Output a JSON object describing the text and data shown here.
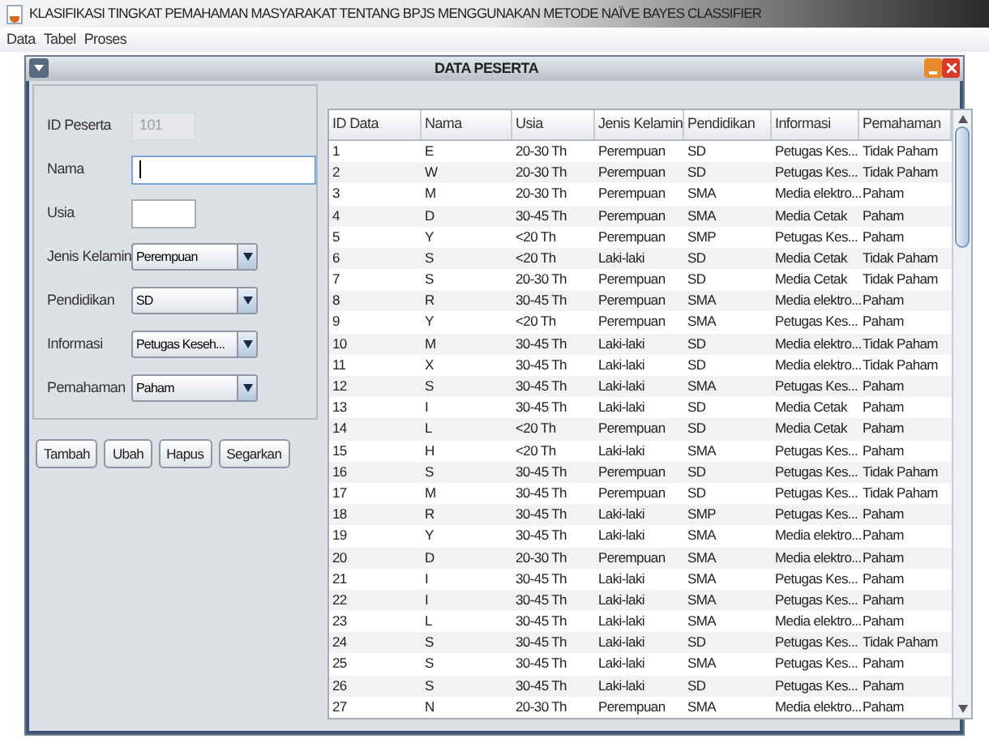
{
  "window": {
    "title": "KLASIFIKASI TINGKAT PEMAHAMAN MASYARAKAT TENTANG BPJS MENGGUNAKAN METODE NAÏVE BAYES CLASSIFIER"
  },
  "menu": [
    "Data",
    "Tabel",
    "Proses"
  ],
  "frame": {
    "title": "DATA PESERTA"
  },
  "form": [
    {
      "kind": "text",
      "label": "ID Peserta",
      "value": "101",
      "disabled": true,
      "focused": false,
      "wide": false
    },
    {
      "kind": "text",
      "label": "Nama",
      "disabled": false,
      "focused": true,
      "wide": true
    },
    {
      "kind": "text",
      "label": "Usia",
      "disabled": false,
      "focused": false,
      "wide": false
    },
    {
      "kind": "combo",
      "label": "Jenis Kelamin",
      "value": "Perempuan"
    },
    {
      "kind": "combo",
      "label": "Pendidikan",
      "value": "SD"
    },
    {
      "kind": "combo",
      "label": "Informasi",
      "value": "Petugas Keseh..."
    },
    {
      "kind": "combo",
      "label": "Pemahaman",
      "value": "Paham"
    }
  ],
  "buttons": [
    "Tambah",
    "Ubah",
    "Hapus",
    "Segarkan"
  ],
  "table": {
    "columns": [
      "ID Data",
      "Nama",
      "Usia",
      "Jenis Kelamin",
      "Pendidikan",
      "Informasi",
      "Pemahaman"
    ],
    "rows": [
      [
        "1",
        "E",
        "20-30 Th",
        "Perempuan",
        "SD",
        "Petugas Kes...",
        "Tidak Paham"
      ],
      [
        "2",
        "W",
        "20-30 Th",
        "Perempuan",
        "SD",
        "Petugas Kes...",
        "Tidak Paham"
      ],
      [
        "3",
        "M",
        "20-30 Th",
        "Perempuan",
        "SMA",
        "Media elektro...",
        "Paham"
      ],
      [
        "4",
        "D",
        "30-45 Th",
        "Perempuan",
        "SMA",
        "Media Cetak",
        "Paham"
      ],
      [
        "5",
        "Y",
        "<20 Th",
        "Perempuan",
        "SMP",
        "Petugas Kes...",
        "Paham"
      ],
      [
        "6",
        "S",
        "<20 Th",
        "Laki-laki",
        "SD",
        "Media Cetak",
        "Tidak Paham"
      ],
      [
        "7",
        "S",
        "20-30 Th",
        "Perempuan",
        "SD",
        "Media Cetak",
        "Tidak Paham"
      ],
      [
        "8",
        "R",
        "30-45 Th",
        "Perempuan",
        "SMA",
        "Media elektro...",
        "Paham"
      ],
      [
        "9",
        "Y",
        "<20 Th",
        "Perempuan",
        "SMA",
        "Petugas Kes...",
        "Paham"
      ],
      [
        "10",
        "M",
        "30-45 Th",
        "Laki-laki",
        "SD",
        "Media elektro...",
        "Tidak Paham"
      ],
      [
        "11",
        "X",
        "30-45 Th",
        "Laki-laki",
        "SD",
        "Media elektro...",
        "Tidak Paham"
      ],
      [
        "12",
        "S",
        "30-45 Th",
        "Laki-laki",
        "SMA",
        "Petugas Kes...",
        "Paham"
      ],
      [
        "13",
        "I",
        "30-45 Th",
        "Laki-laki",
        "SD",
        "Media Cetak",
        "Paham"
      ],
      [
        "14",
        "L",
        "<20 Th",
        "Perempuan",
        "SD",
        "Media Cetak",
        "Paham"
      ],
      [
        "15",
        "H",
        "<20 Th",
        "Laki-laki",
        "SMA",
        "Petugas Kes...",
        "Paham"
      ],
      [
        "16",
        "S",
        "30-45 Th",
        "Perempuan",
        "SD",
        "Petugas Kes...",
        "Tidak Paham"
      ],
      [
        "17",
        "M",
        "30-45 Th",
        "Perempuan",
        "SD",
        "Petugas Kes...",
        "Tidak Paham"
      ],
      [
        "18",
        "R",
        "30-45 Th",
        "Laki-laki",
        "SMP",
        "Petugas Kes...",
        "Paham"
      ],
      [
        "19",
        "Y",
        "30-45 Th",
        "Laki-laki",
        "SMA",
        "Media elektro...",
        "Paham"
      ],
      [
        "20",
        "D",
        "20-30 Th",
        "Perempuan",
        "SMA",
        "Media elektro...",
        "Paham"
      ],
      [
        "21",
        "I",
        "30-45 Th",
        "Laki-laki",
        "SMA",
        "Petugas Kes...",
        "Paham"
      ],
      [
        "22",
        "I",
        "30-45 Th",
        "Laki-laki",
        "SMA",
        "Petugas Kes...",
        "Paham"
      ],
      [
        "23",
        "L",
        "30-45 Th",
        "Laki-laki",
        "SMA",
        "Media elektro...",
        "Paham"
      ],
      [
        "24",
        "S",
        "30-45 Th",
        "Laki-laki",
        "SD",
        "Petugas Kes...",
        "Tidak Paham"
      ],
      [
        "25",
        "S",
        "30-45 Th",
        "Laki-laki",
        "SMA",
        "Petugas Kes...",
        "Paham"
      ],
      [
        "26",
        "S",
        "30-45 Th",
        "Laki-laki",
        "SD",
        "Petugas Kes...",
        "Paham"
      ],
      [
        "27",
        "N",
        "20-30 Th",
        "Perempuan",
        "SMA",
        "Media elektro...",
        "Paham"
      ]
    ]
  }
}
